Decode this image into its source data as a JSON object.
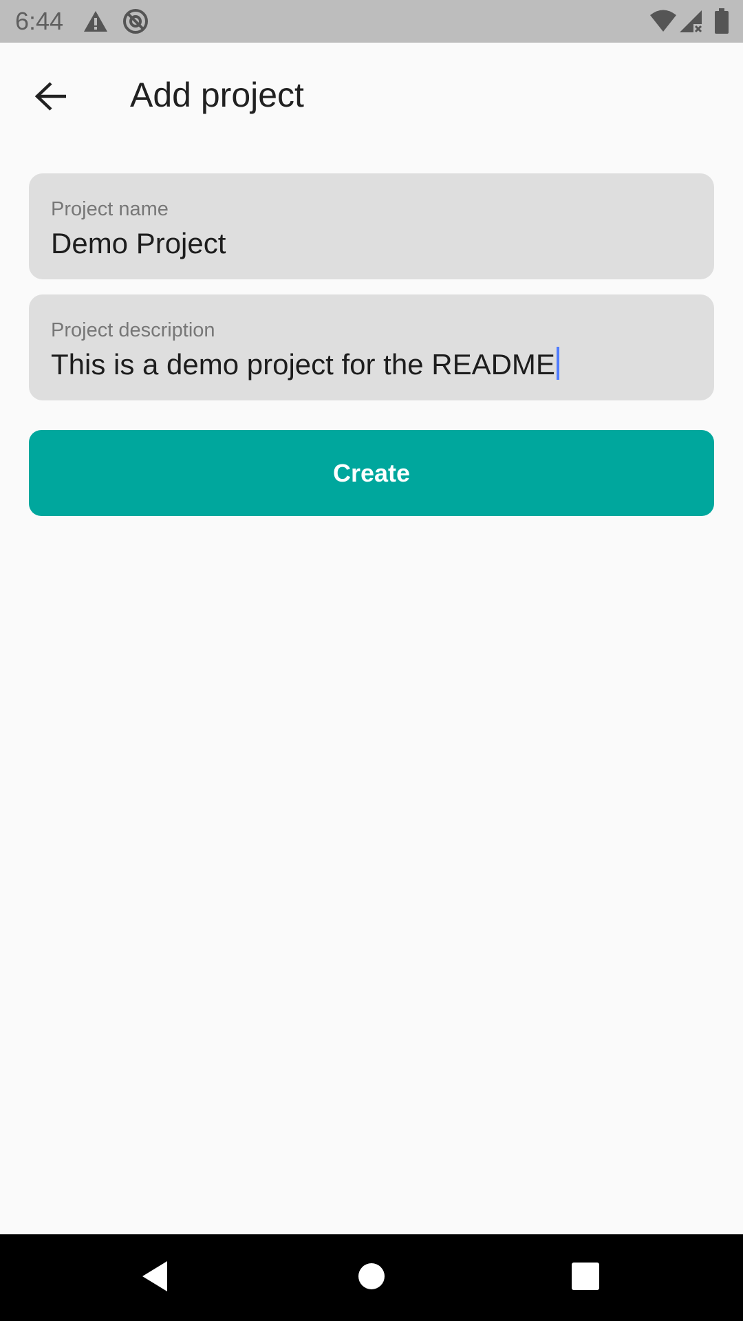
{
  "status_bar": {
    "time": "6:44",
    "icons": [
      "alert-triangle-icon",
      "no-sync-icon",
      "wifi-icon",
      "signal-no-data-icon",
      "battery-icon"
    ]
  },
  "app_bar": {
    "back_icon": "arrow-back-icon",
    "title": "Add project"
  },
  "form": {
    "project_name": {
      "label": "Project name",
      "value": "Demo Project"
    },
    "project_description": {
      "label": "Project description",
      "value": "This is a demo project for the README",
      "focused": true
    },
    "create_label": "Create"
  },
  "colors": {
    "accent": "#00a79d",
    "field_bg": "#dedede",
    "caret": "#4f7cff",
    "status_bar_bg": "#bdbdbd",
    "nav_bar_bg": "#000000"
  },
  "nav_bar": {
    "icons": [
      "back-triangle-icon",
      "home-circle-icon",
      "recents-square-icon"
    ]
  }
}
